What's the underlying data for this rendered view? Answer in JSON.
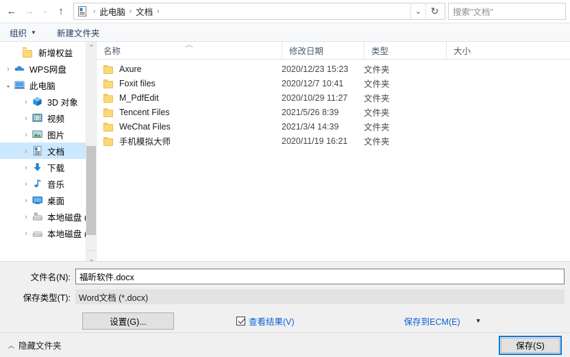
{
  "nav": {
    "back_icon": "back-arrow-icon",
    "forward_icon": "forward-arrow-icon",
    "recent_icon": "chevron-down-icon",
    "up_icon": "up-arrow-icon",
    "breadcrumbs": [
      "此电脑",
      "文档"
    ],
    "breadcrumb_sep": "›",
    "address_dropdown_icon": "chevron-down-icon",
    "refresh_icon": "refresh-icon",
    "search_placeholder": "搜索\"文档\""
  },
  "commandbar": {
    "organize_label": "组织",
    "organize_caret": "▼",
    "new_folder_label": "新建文件夹"
  },
  "sidebar": {
    "items": [
      {
        "label": "新增权益",
        "icon": "folder-icon",
        "indent": 2,
        "twisty": "",
        "selected": false
      },
      {
        "label": "WPS网盘",
        "icon": "cloud-icon",
        "indent": 1,
        "twisty": "›",
        "selected": false
      },
      {
        "label": "此电脑",
        "icon": "computer-icon",
        "indent": 1,
        "twisty": "⌄",
        "selected": false
      },
      {
        "label": "3D 对象",
        "icon": "3d-object-icon",
        "indent": 2,
        "twisty": "›",
        "selected": false
      },
      {
        "label": "视频",
        "icon": "video-icon",
        "indent": 2,
        "twisty": "›",
        "selected": false
      },
      {
        "label": "图片",
        "icon": "picture-icon",
        "indent": 2,
        "twisty": "›",
        "selected": false
      },
      {
        "label": "文档",
        "icon": "document-icon",
        "indent": 2,
        "twisty": "›",
        "selected": true
      },
      {
        "label": "下载",
        "icon": "download-icon",
        "indent": 2,
        "twisty": "›",
        "selected": false
      },
      {
        "label": "音乐",
        "icon": "music-icon",
        "indent": 2,
        "twisty": "›",
        "selected": false
      },
      {
        "label": "桌面",
        "icon": "desktop-icon",
        "indent": 2,
        "twisty": "›",
        "selected": false
      },
      {
        "label": "本地磁盘 (C:)",
        "icon": "system-drive-icon",
        "indent": 2,
        "twisty": "›",
        "selected": false
      },
      {
        "label": "本地磁盘 (D:)",
        "icon": "drive-icon",
        "indent": 2,
        "twisty": "›",
        "selected": false
      }
    ],
    "scroll_up_icon": "scroll-up-arrow",
    "scroll_down_icon": "scroll-down-arrow"
  },
  "filelist": {
    "columns": [
      "名称",
      "修改日期",
      "类型",
      "大小"
    ],
    "sort_column": "名称",
    "sort_indicator": "︿",
    "rows": [
      {
        "name": "Axure",
        "date": "2020/12/23 15:23",
        "type": "文件夹",
        "size": ""
      },
      {
        "name": "Foxit files",
        "date": "2020/12/7 10:41",
        "type": "文件夹",
        "size": ""
      },
      {
        "name": "M_PdfEdit",
        "date": "2020/10/29 11:27",
        "type": "文件夹",
        "size": ""
      },
      {
        "name": "Tencent Files",
        "date": "2021/5/26 8:39",
        "type": "文件夹",
        "size": ""
      },
      {
        "name": "WeChat Files",
        "date": "2021/3/4 14:39",
        "type": "文件夹",
        "size": ""
      },
      {
        "name": "手机模拟大师",
        "date": "2020/11/19 16:21",
        "type": "文件夹",
        "size": ""
      }
    ]
  },
  "form": {
    "filename_label": "文件名(N):",
    "filename_value": "福昕软件.docx",
    "filetype_label": "保存类型(T):",
    "filetype_value": "Word文档 (*.docx)",
    "settings_button": "设置(G)...",
    "view_result_label": "查看结果(V)",
    "view_result_checked": true,
    "ecm_link": "保存到ECM(E)",
    "ecm_caret": "▼"
  },
  "footer": {
    "hide_folders_label": "隐藏文件夹",
    "hide_folders_caret": "︿",
    "save_button": "保存(S)"
  },
  "colors": {
    "selection": "#cce8ff",
    "focus_blue": "#0078d7",
    "link_blue": "#0c5fd4",
    "folder_yellow": "#fbd97a"
  }
}
